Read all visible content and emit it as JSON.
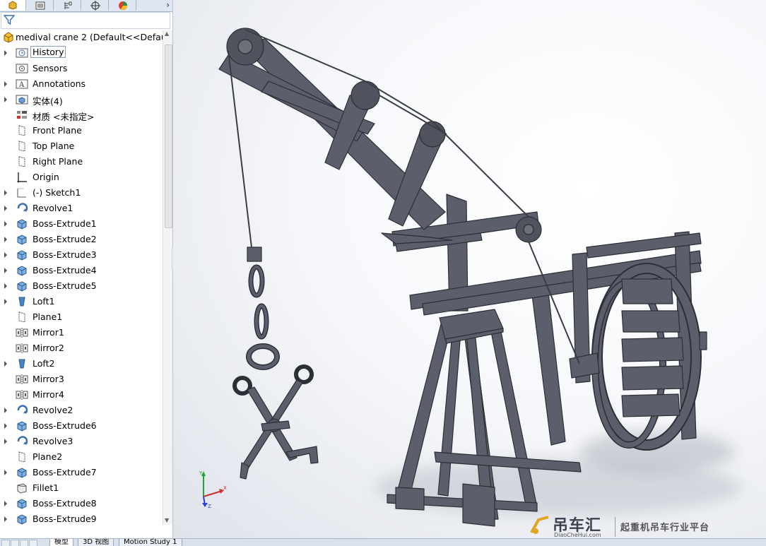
{
  "panel": {
    "filter": {
      "icon": "funnel-icon"
    },
    "root": {
      "label": "medival crane 2  (Default<<Default",
      "icon": "part-icon"
    },
    "tree_items": [
      {
        "label": "History",
        "icon": "history-folder-icon",
        "expandable": true,
        "selected": true
      },
      {
        "label": "Sensors",
        "icon": "sensors-icon",
        "expandable": false
      },
      {
        "label": "Annotations",
        "icon": "annotations-icon",
        "expandable": true
      },
      {
        "label": "实体(4)",
        "icon": "solid-bodies-icon",
        "expandable": true
      },
      {
        "label": "材质 <未指定>",
        "icon": "material-icon",
        "expandable": false
      },
      {
        "label": "Front Plane",
        "icon": "plane-icon",
        "expandable": false
      },
      {
        "label": "Top Plane",
        "icon": "plane-icon",
        "expandable": false
      },
      {
        "label": "Right Plane",
        "icon": "plane-icon",
        "expandable": false
      },
      {
        "label": "Origin",
        "icon": "origin-icon",
        "expandable": false
      },
      {
        "label": "(-) Sketch1",
        "icon": "sketch-icon",
        "expandable": true
      },
      {
        "label": "Revolve1",
        "icon": "revolve-icon",
        "expandable": true
      },
      {
        "label": "Boss-Extrude1",
        "icon": "extrude-icon",
        "expandable": true
      },
      {
        "label": "Boss-Extrude2",
        "icon": "extrude-icon",
        "expandable": true
      },
      {
        "label": "Boss-Extrude3",
        "icon": "extrude-icon",
        "expandable": true
      },
      {
        "label": "Boss-Extrude4",
        "icon": "extrude-icon",
        "expandable": true
      },
      {
        "label": "Boss-Extrude5",
        "icon": "extrude-icon",
        "expandable": true
      },
      {
        "label": "Loft1",
        "icon": "loft-icon",
        "expandable": true
      },
      {
        "label": "Plane1",
        "icon": "plane-icon",
        "expandable": false
      },
      {
        "label": "Mirror1",
        "icon": "mirror-icon",
        "expandable": false
      },
      {
        "label": "Mirror2",
        "icon": "mirror-icon",
        "expandable": false
      },
      {
        "label": "Loft2",
        "icon": "loft-icon",
        "expandable": true
      },
      {
        "label": "Mirror3",
        "icon": "mirror-icon",
        "expandable": false
      },
      {
        "label": "Mirror4",
        "icon": "mirror-icon",
        "expandable": false
      },
      {
        "label": "Revolve2",
        "icon": "revolve-icon",
        "expandable": true
      },
      {
        "label": "Boss-Extrude6",
        "icon": "extrude-icon",
        "expandable": true
      },
      {
        "label": "Revolve3",
        "icon": "revolve-icon",
        "expandable": true
      },
      {
        "label": "Plane2",
        "icon": "plane-icon",
        "expandable": false
      },
      {
        "label": "Boss-Extrude7",
        "icon": "extrude-icon",
        "expandable": true
      },
      {
        "label": "Fillet1",
        "icon": "fillet-icon",
        "expandable": false
      },
      {
        "label": "Boss-Extrude8",
        "icon": "extrude-icon",
        "expandable": true
      },
      {
        "label": "Boss-Extrude9",
        "icon": "extrude-icon",
        "expandable": true
      }
    ]
  },
  "manager_tabs": [
    {
      "icon": "feature-manager-icon",
      "active": true
    },
    {
      "icon": "property-manager-icon"
    },
    {
      "icon": "configuration-manager-icon"
    },
    {
      "icon": "dimxpert-icon"
    },
    {
      "icon": "display-manager-icon"
    }
  ],
  "bottom_tabs": [
    "模型",
    "3D 视图",
    "Motion Study 1"
  ],
  "triad": {
    "x": "X",
    "y": "Y",
    "z": "Z"
  },
  "watermark": {
    "brand": "吊车汇",
    "domain": "DiaoCheHui.com",
    "slogan": "起重机吊车行业平台"
  },
  "colors": {
    "model": "#5b5f6b",
    "model_dark": "#3f434d",
    "panel_bg": "#ffffff",
    "tab_bg": "#dde6f1"
  }
}
